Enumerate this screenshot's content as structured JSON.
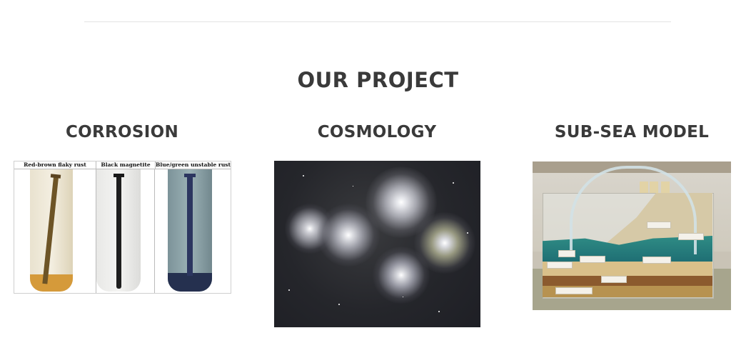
{
  "section": {
    "title": "OUR PROJECT"
  },
  "cards": [
    {
      "title": "CORROSION",
      "image": {
        "columns": [
          "Red-brown flaky rust",
          "Black magnetite",
          "Blue/green unstable rust"
        ]
      }
    },
    {
      "title": "COSMOLOGY"
    },
    {
      "title": "SUB-SEA MODEL"
    }
  ],
  "colors": {
    "heading": "#3a3a3a",
    "divider": "#e3e3e3"
  }
}
